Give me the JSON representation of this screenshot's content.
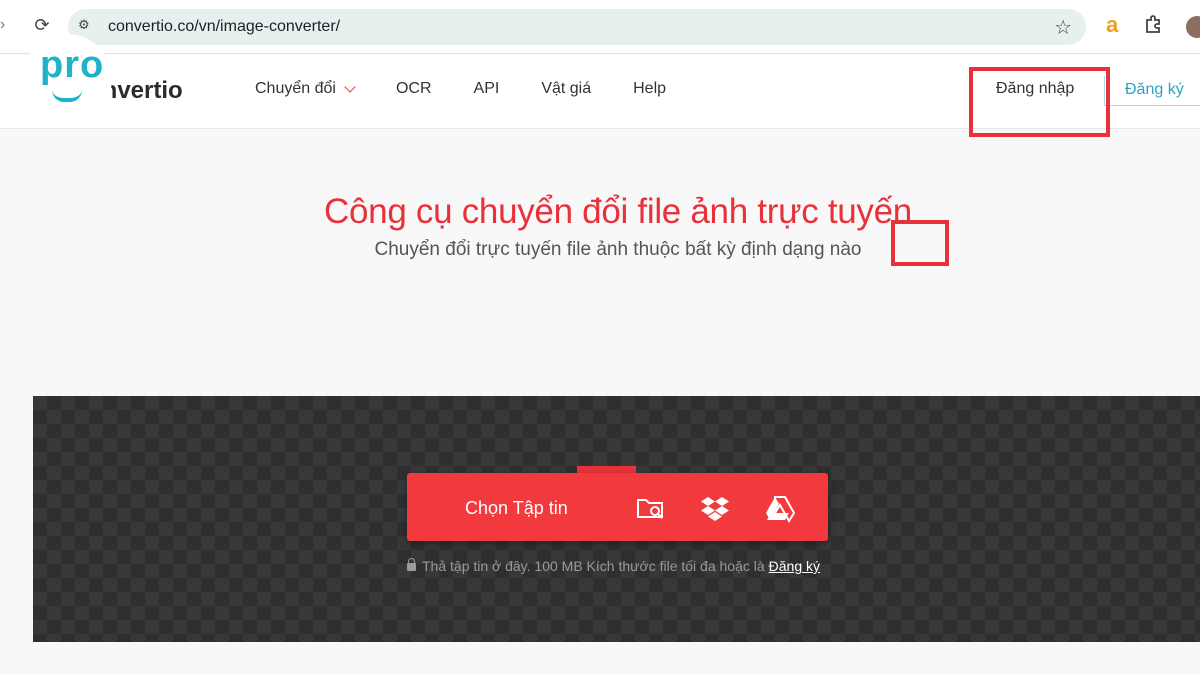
{
  "browser": {
    "url": "convertio.co/vn/image-converter/",
    "extension_letter": "a"
  },
  "watermark": {
    "text": "pro"
  },
  "header": {
    "logo_text": "onvertio",
    "nav": [
      {
        "label": "Chuyển đổi"
      },
      {
        "label": "OCR"
      },
      {
        "label": "API"
      },
      {
        "label": "Vật giá"
      },
      {
        "label": "Help"
      }
    ],
    "login_label": "Đăng nhập",
    "signup_label": "Đăng ký"
  },
  "hero": {
    "title": "Công cụ chuyển đổi file ảnh trực tuyến",
    "subtitle": "Chuyển đổi trực tuyến file ảnh thuộc bất kỳ định dạng nào"
  },
  "upload": {
    "choose_label": "Chọn Tập tin",
    "hint_text": "Thả tập tin ở đây. 100 MB Kích thước file tối đa hoặc là",
    "hint_link": "Đăng ký"
  },
  "colors": {
    "accent": "#e8313b",
    "upload_button": "#f23a3e",
    "dropzone": "#383838",
    "signup_text": "#2ea3c0"
  }
}
